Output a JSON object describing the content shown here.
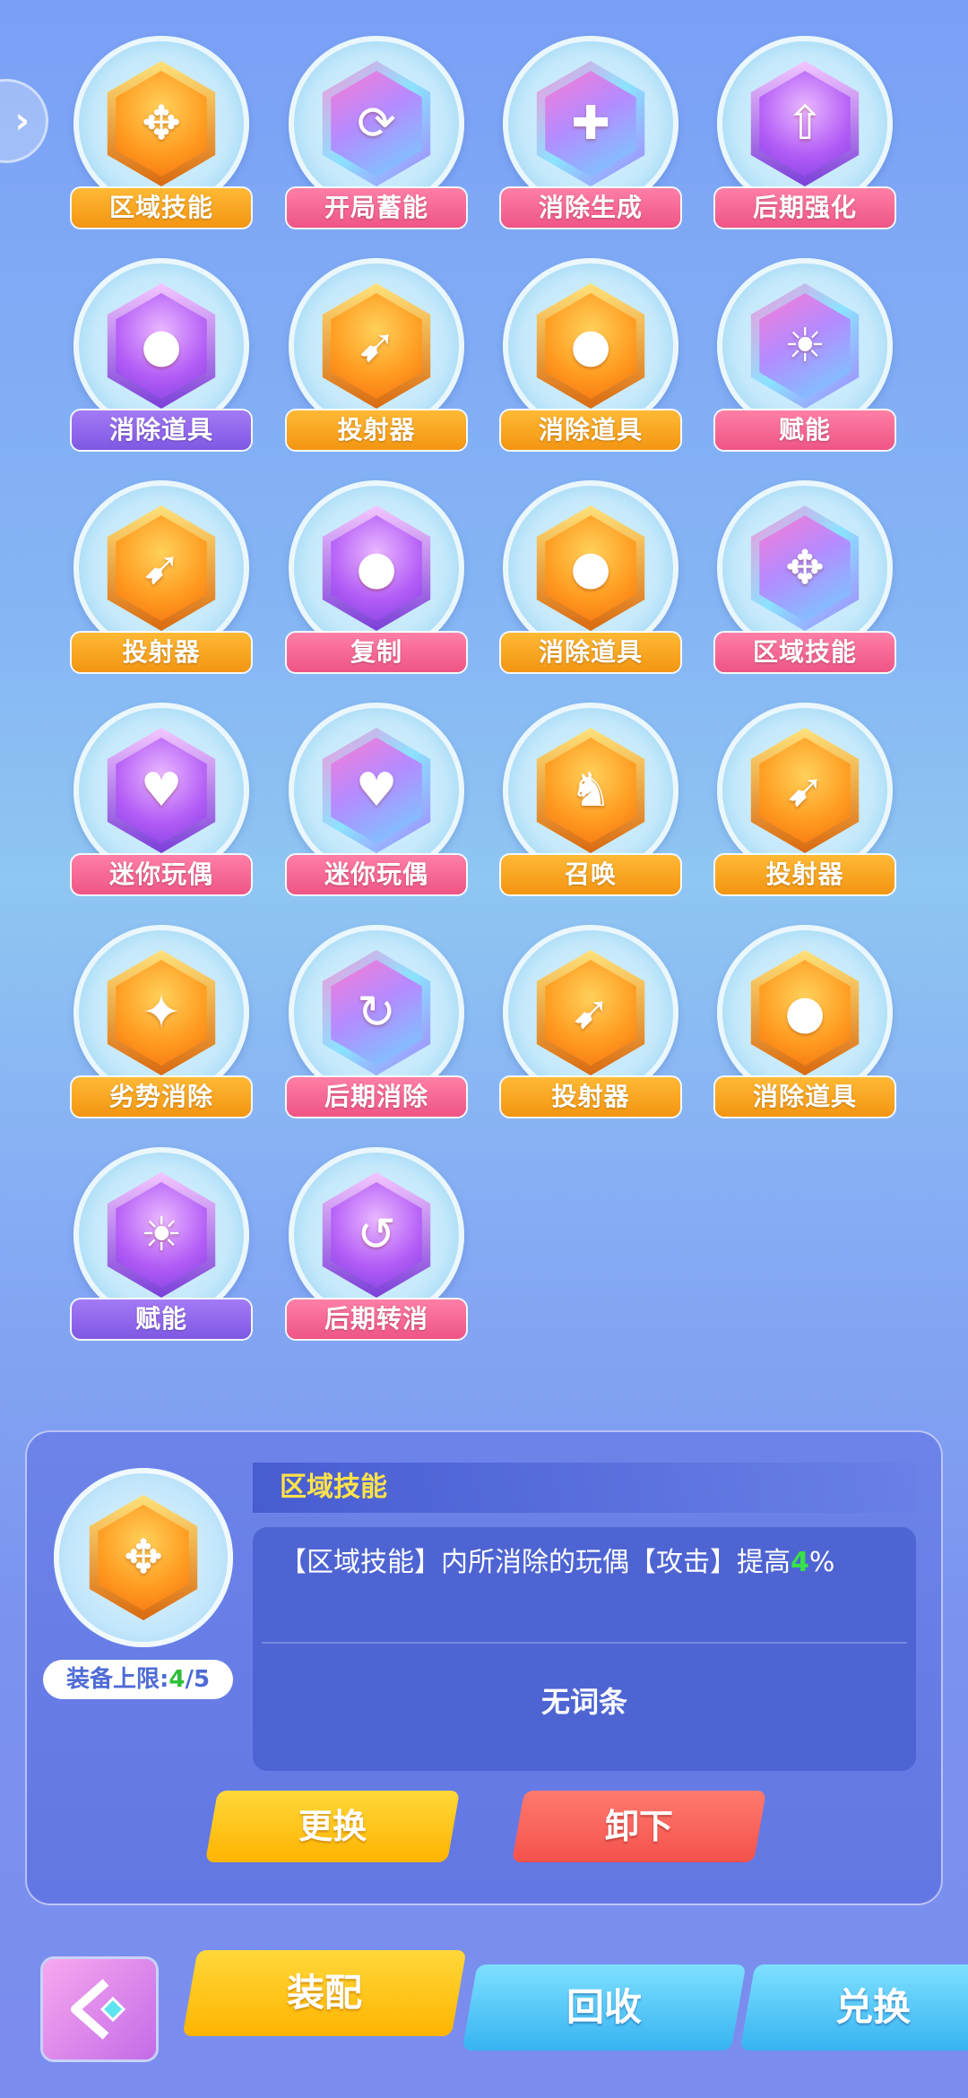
{
  "nav": {
    "side_arrow": "›",
    "back_icon": "back-arrow-icon"
  },
  "grid": {
    "items": [
      {
        "label": "区域技能",
        "color": "orange",
        "icon": "area-skill-icon",
        "glyph": "✥"
      },
      {
        "label": "开局蓄能",
        "color": "pink",
        "icon": "charge-icon",
        "glyph": "⟳"
      },
      {
        "label": "消除生成",
        "color": "pink",
        "icon": "generate-icon",
        "glyph": "✚"
      },
      {
        "label": "后期强化",
        "color": "pink",
        "icon": "upgrade-icon",
        "glyph": "⇧"
      },
      {
        "label": "消除道具",
        "color": "violet",
        "icon": "bomb-icon",
        "glyph": "●"
      },
      {
        "label": "投射器",
        "color": "orange",
        "icon": "cannon-icon",
        "glyph": "➹"
      },
      {
        "label": "消除道具",
        "color": "orange",
        "icon": "bomb-icon",
        "glyph": "●"
      },
      {
        "label": "赋能",
        "color": "pink",
        "icon": "empower-icon",
        "glyph": "☀"
      },
      {
        "label": "投射器",
        "color": "orange",
        "icon": "cannon-icon",
        "glyph": "➹"
      },
      {
        "label": "复制",
        "color": "pink",
        "icon": "copy-icon",
        "glyph": "●"
      },
      {
        "label": "消除道具",
        "color": "orange",
        "icon": "bomb-icon",
        "glyph": "●"
      },
      {
        "label": "区域技能",
        "color": "pink",
        "icon": "area-skill-icon",
        "glyph": "✥"
      },
      {
        "label": "迷你玩偶",
        "color": "pink",
        "icon": "bear-icon",
        "glyph": "♥"
      },
      {
        "label": "迷你玩偶",
        "color": "pink",
        "icon": "bear-icon",
        "glyph": "♥"
      },
      {
        "label": "召唤",
        "color": "orange",
        "icon": "summon-icon",
        "glyph": "♞"
      },
      {
        "label": "投射器",
        "color": "orange",
        "icon": "cannon-icon",
        "glyph": "➹"
      },
      {
        "label": "劣势消除",
        "color": "orange",
        "icon": "disadvantage-icon",
        "glyph": "✦"
      },
      {
        "label": "后期消除",
        "color": "pink",
        "icon": "timer-icon",
        "glyph": "↻"
      },
      {
        "label": "投射器",
        "color": "orange",
        "icon": "cannon-icon",
        "glyph": "➹"
      },
      {
        "label": "消除道具",
        "color": "orange",
        "icon": "bomb-icon",
        "glyph": "●"
      },
      {
        "label": "赋能",
        "color": "violet",
        "icon": "empower-icon",
        "glyph": "☀"
      },
      {
        "label": "后期转消",
        "color": "pink",
        "icon": "convert-icon",
        "glyph": "↺"
      }
    ]
  },
  "detail": {
    "icon": "area-skill-icon",
    "glyph": "✥",
    "limit_prefix": "装备上限:",
    "limit_current": "4",
    "limit_suffix": "/5",
    "title": "区域技能",
    "desc_prefix": "【区域技能】内所消除的玩偶【攻击】提高",
    "desc_value": "4",
    "desc_suffix": "%",
    "no_entry": "无词条",
    "btn_replace": "更换",
    "btn_unload": "卸下"
  },
  "bottom_tabs": {
    "equip": "装配",
    "recycle": "回收",
    "exchange": "兑换"
  }
}
